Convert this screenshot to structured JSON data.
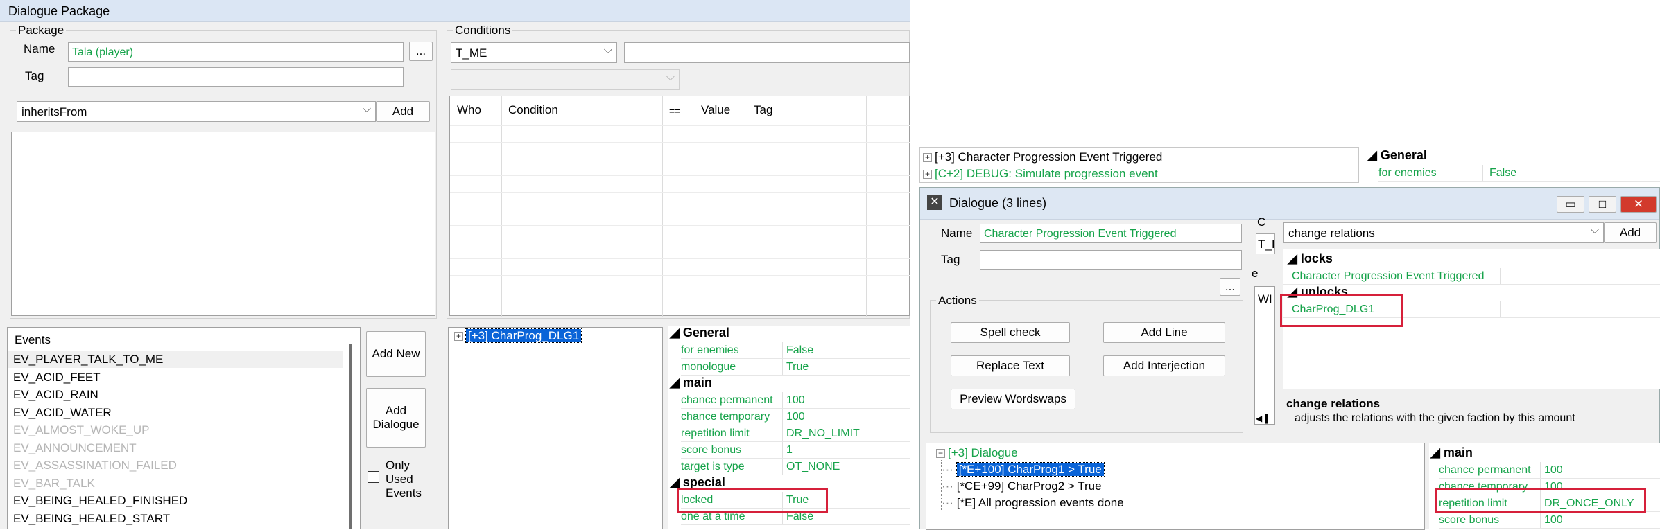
{
  "left": {
    "title": "Dialogue Package",
    "package_group": "Package",
    "name_label": "Name",
    "name_value": "Tala (player)",
    "browse_label": "...",
    "tag_label": "Tag",
    "tag_value": "",
    "inherits_combo": "inheritsFrom",
    "add_label": "Add",
    "conditions_group": "Conditions",
    "cond_combo": "T_ME",
    "cond_headers": [
      "Who",
      "Condition",
      "==",
      "Value",
      "Tag"
    ],
    "events_label": "Events",
    "events": [
      {
        "label": "EV_PLAYER_TALK_TO_ME",
        "muted": false
      },
      {
        "label": "EV_ACID_FEET",
        "muted": false
      },
      {
        "label": "EV_ACID_RAIN",
        "muted": false
      },
      {
        "label": "EV_ACID_WATER",
        "muted": false
      },
      {
        "label": "EV_ALMOST_WOKE_UP",
        "muted": true
      },
      {
        "label": "EV_ANNOUNCEMENT",
        "muted": true
      },
      {
        "label": "EV_ASSASSINATION_FAILED",
        "muted": true
      },
      {
        "label": "EV_BAR_TALK",
        "muted": true
      },
      {
        "label": "EV_BEING_HEALED_FINISHED",
        "muted": false
      },
      {
        "label": "EV_BEING_HEALED_START",
        "muted": false
      }
    ],
    "add_new_label": "Add New",
    "add_dialogue_label": "Add Dialogue",
    "only_used_label": "Only Used Events",
    "tree_item": "[+3] CharProg_DLG1",
    "props": {
      "general": "General",
      "main": "main",
      "special": "special",
      "rows": [
        {
          "k": "for enemies",
          "v": "False"
        },
        {
          "k": "monologue",
          "v": "True"
        },
        {
          "k": "chance permanent",
          "v": "100"
        },
        {
          "k": "chance temporary",
          "v": "100"
        },
        {
          "k": "repetition limit",
          "v": "DR_NO_LIMIT"
        },
        {
          "k": "score bonus",
          "v": "1"
        },
        {
          "k": "target is type",
          "v": "OT_NONE"
        },
        {
          "k": "locked",
          "v": "True"
        },
        {
          "k": "one at a time",
          "v": "False"
        }
      ]
    }
  },
  "right": {
    "bg_tree": [
      "[+3] Character Progression Event Triggered",
      "[C+2] DEBUG: Simulate progression event"
    ],
    "bg_general": "General",
    "bg_row": {
      "k": "for enemies",
      "v": "False"
    },
    "dialog_title": "Dialogue (3 lines)",
    "name_label": "Name",
    "name_value": "Character Progression Event Triggered",
    "tag_label": "Tag",
    "browse_label": "...",
    "c_label": "C",
    "t_combo": "T_I",
    "e_label": "e",
    "w_label": "WI",
    "actions_label": "Actions",
    "spell_check": "Spell check",
    "add_line": "Add Line",
    "replace_text": "Replace Text",
    "add_interjection": "Add Interjection",
    "preview_wordswaps": "Preview Wordswaps",
    "effect_combo": "change relations",
    "add_label": "Add",
    "locks_label": "locks",
    "locks_item": "Character Progression Event Triggered",
    "unlocks_label": "unlocks",
    "unlocks_item": "CharProg_DLG1",
    "desc_title": "change relations",
    "desc_text": "adjusts the relations with the given faction by this amount",
    "tree_root": "[+3] Dialogue",
    "tree_children": [
      "[*E+100] CharProg1 > True",
      "[*CE+99] CharProg2 > True",
      "[*E] All progression events done"
    ],
    "main_label": "main",
    "rows": [
      {
        "k": "chance permanent",
        "v": "100"
      },
      {
        "k": "chance temporary",
        "v": "100"
      },
      {
        "k": "repetition limit",
        "v": "DR_ONCE_ONLY"
      },
      {
        "k": "score bonus",
        "v": "100"
      }
    ]
  }
}
